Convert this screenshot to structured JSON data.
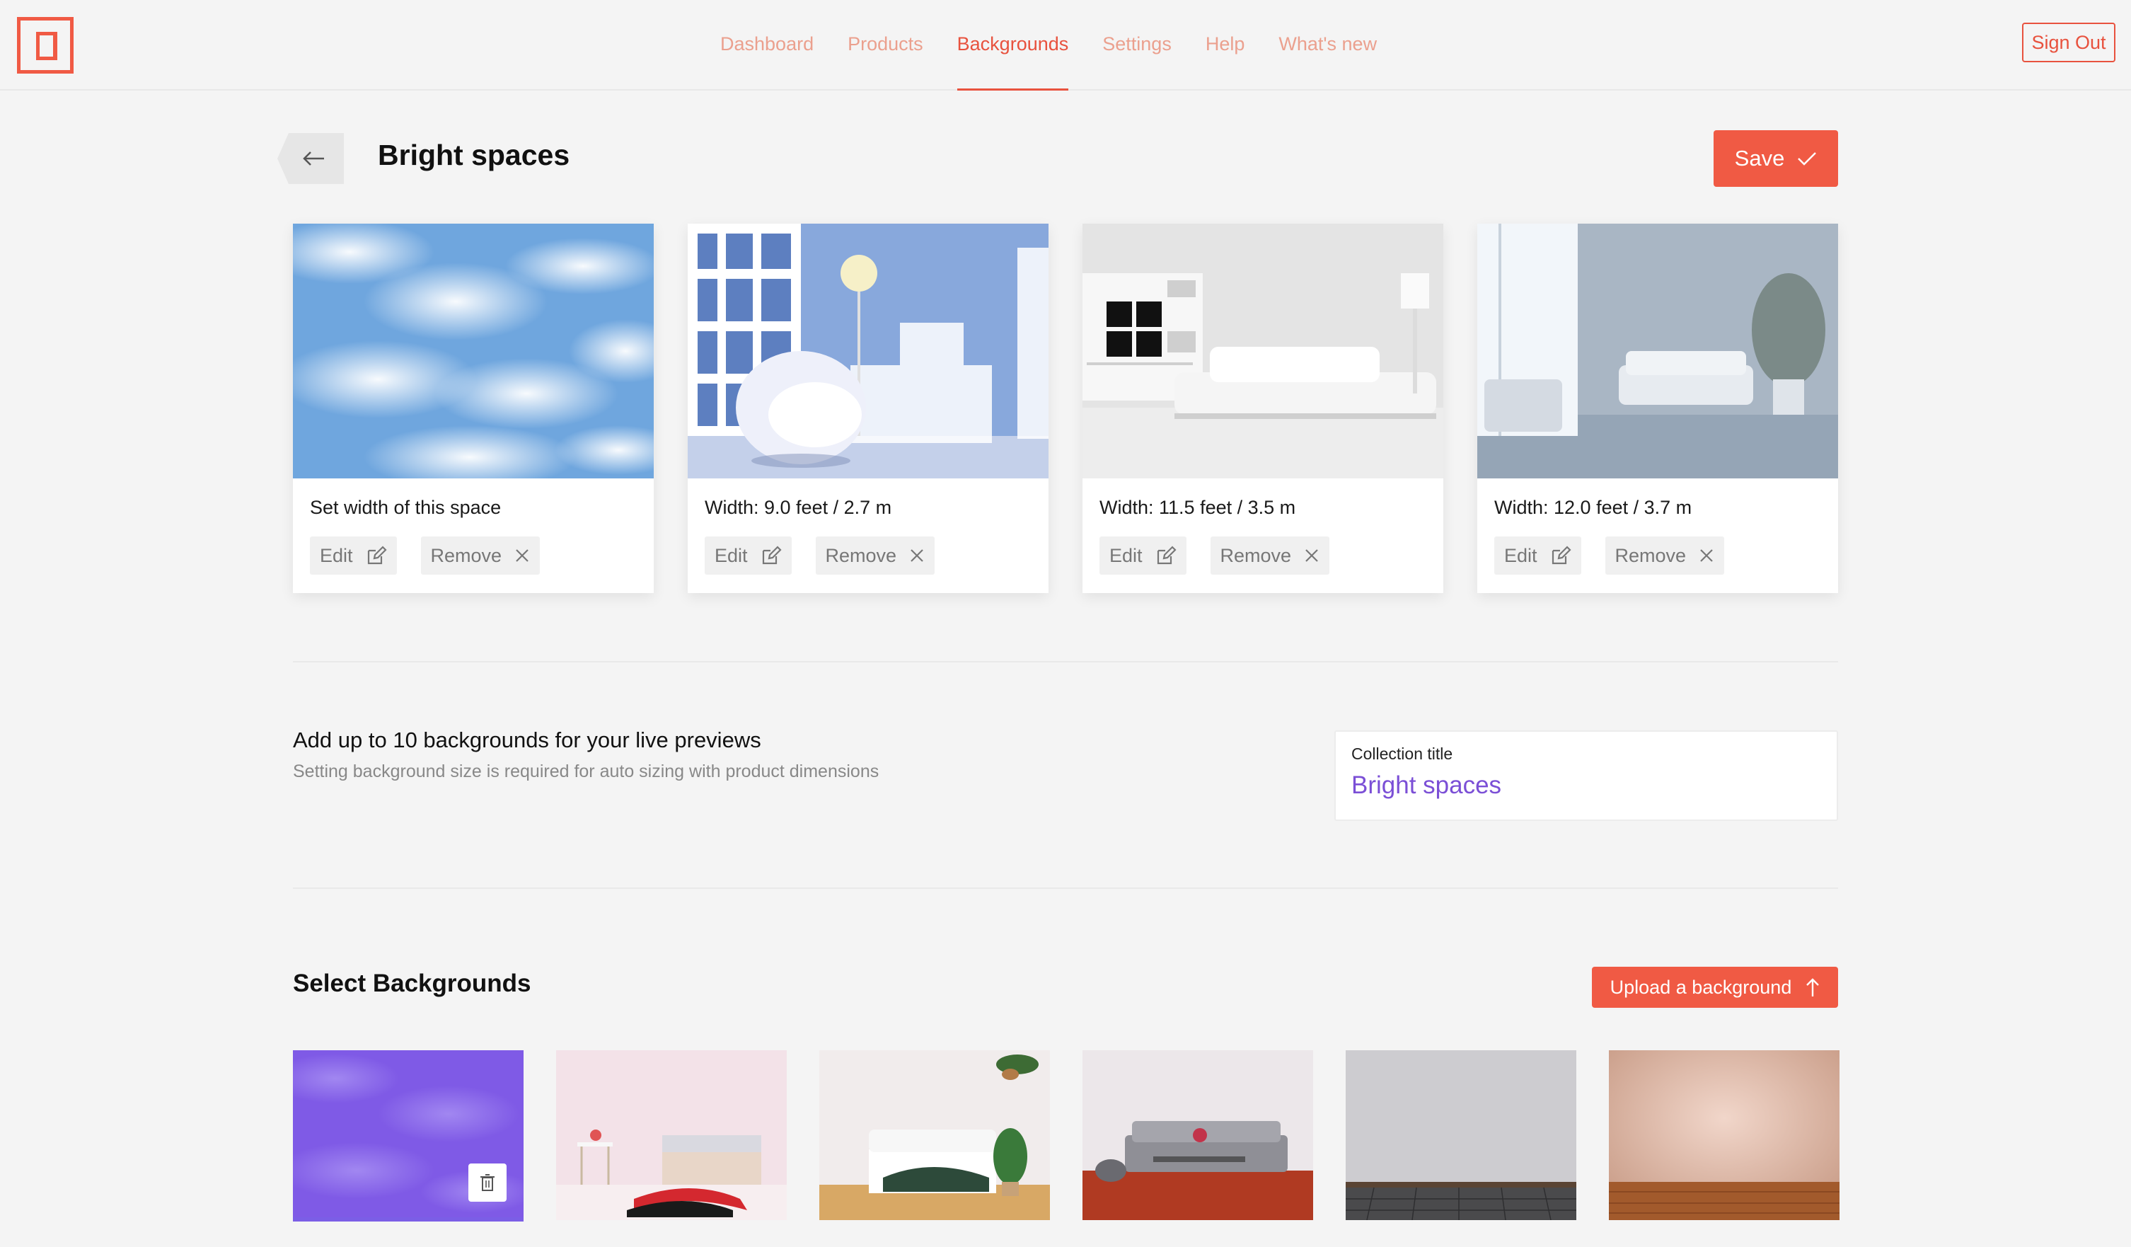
{
  "nav": {
    "items": [
      "Dashboard",
      "Products",
      "Backgrounds",
      "Settings",
      "Help",
      "What's new"
    ],
    "active": "Backgrounds",
    "sign_out": "Sign Out"
  },
  "header": {
    "title": "Bright spaces",
    "save_label": "Save"
  },
  "cards": [
    {
      "caption": "Set width of this space",
      "edit": "Edit",
      "remove": "Remove",
      "image": "sky-clouds"
    },
    {
      "caption": "Width: 9.0 feet / 2.7 m",
      "edit": "Edit",
      "remove": "Remove",
      "image": "blue-room-chair"
    },
    {
      "caption": "Width: 11.5 feet / 3.5 m",
      "edit": "Edit",
      "remove": "Remove",
      "image": "white-living-room"
    },
    {
      "caption": "Width: 12.0 feet / 3.7 m",
      "edit": "Edit",
      "remove": "Remove",
      "image": "blue-grey-lounge"
    }
  ],
  "info": {
    "title": "Add up to 10 backgrounds for your live previews",
    "subtitle": "Setting background size is required for auto sizing with product dimensions"
  },
  "collection": {
    "label": "Collection title",
    "value": "Bright spaces"
  },
  "select": {
    "title": "Select Backgrounds",
    "upload_label": "Upload a background"
  },
  "thumbnails": [
    {
      "image": "purple-clouds",
      "selected": true
    },
    {
      "image": "pink-bedroom",
      "selected": false
    },
    {
      "image": "white-bedroom-plants",
      "selected": false
    },
    {
      "image": "grey-sofa-red-rug",
      "selected": false
    },
    {
      "image": "grey-wall-tile-floor",
      "selected": false
    },
    {
      "image": "peach-wall-wood-floor",
      "selected": false
    }
  ],
  "colors": {
    "accent": "#f05a44",
    "nav_inactive": "#eba08e",
    "collection_value": "#7b4fd6",
    "selected_border": "#7b5ee6"
  }
}
